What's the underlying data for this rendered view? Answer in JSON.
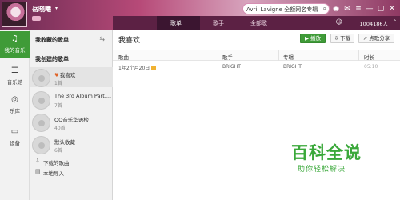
{
  "user": {
    "name": "岳晓曦",
    "caret": "▾"
  },
  "search": {
    "value": "Avril Lavigne 全额网名专辑",
    "icon": "search-icon"
  },
  "window_controls": [
    {
      "name": "skin-icon",
      "glyph": "◉"
    },
    {
      "name": "message-icon",
      "glyph": "✉"
    },
    {
      "name": "menu-icon",
      "glyph": "≡"
    },
    {
      "name": "minimize-icon",
      "glyph": "—"
    },
    {
      "name": "maximize-icon",
      "glyph": "▢"
    },
    {
      "name": "close-icon",
      "glyph": "✕"
    }
  ],
  "rail": {
    "items": [
      {
        "label": "我的音乐",
        "icon": "♫",
        "active": true
      },
      {
        "label": "音乐馆",
        "icon": "☰"
      },
      {
        "label": "乐库",
        "icon": "◎"
      },
      {
        "label": "设备",
        "icon": "▭"
      }
    ]
  },
  "panel": {
    "collected_header": "我收藏的歌单",
    "collected_icon": "⇆",
    "created_header": "我创建的歌单",
    "playlists": [
      {
        "name": "我喜欢",
        "count": "1首",
        "heart": "♥"
      },
      {
        "name": "The 3rd Album Part....",
        "count": "7首"
      },
      {
        "name": "QQ音乐华语榜",
        "count": "40首"
      },
      {
        "name": "默认收藏",
        "count": "6首"
      }
    ],
    "footer": [
      {
        "label": "下载的歌曲",
        "icon": "⇩"
      },
      {
        "label": "本地导入",
        "icon": "▤"
      }
    ]
  },
  "tabs": {
    "items": [
      "歌单",
      "歌手",
      "全部歌"
    ],
    "active_index": 0
  },
  "user_status": {
    "label": "1004186人",
    "icon": "☺",
    "collapse": "⌃"
  },
  "main": {
    "title": "我喜欢",
    "buttons": [
      {
        "label": "▶ 播放",
        "primary": true
      },
      {
        "label": "⇩ 下载"
      },
      {
        "label": "↗ 点歌分享"
      }
    ],
    "columns": [
      "歌曲",
      "歌手",
      "专辑",
      "时长"
    ],
    "rows": [
      {
        "song": "1年2个月20日",
        "artist": "BRIGHT",
        "album": "BRIGHT",
        "duration": "05:10"
      }
    ]
  },
  "watermark": {
    "main": "百科全说",
    "sub": "助你轻松解决"
  },
  "colors": {
    "accent": "#3f9b38",
    "titlebar": "#b74a78",
    "tabbar": "#5c2144"
  }
}
